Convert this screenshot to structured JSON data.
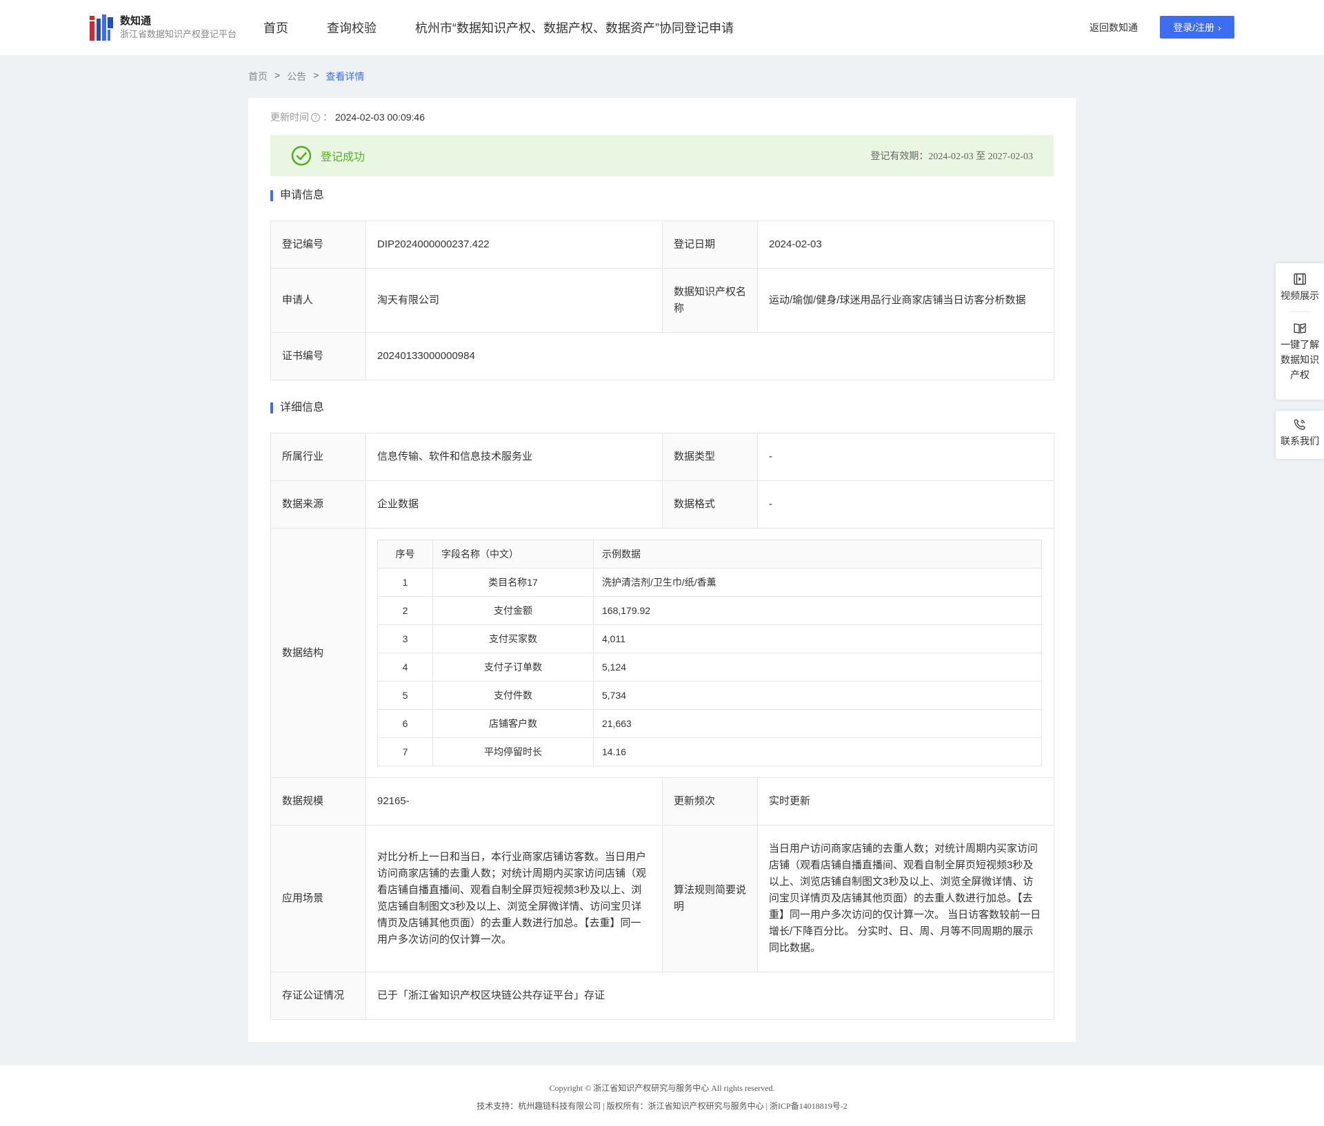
{
  "header": {
    "logo_title": "数知通",
    "logo_sub": "浙江省数据知识产权登记平台",
    "nav": [
      "首页",
      "查询校验",
      "杭州市“数据知识产权、数据产权、数据资产”协同登记申请"
    ],
    "back_link": "返回数知通",
    "login_label": "登录/注册"
  },
  "breadcrumb": {
    "items": [
      "首页",
      "公告",
      "查看详情"
    ],
    "sep": ">"
  },
  "update": {
    "label": "更新时间",
    "colon": "：",
    "value": "2024-02-03 00:09:46"
  },
  "status": {
    "text": "登记成功",
    "validity": "登记有效期：2024-02-03 至 2027-02-03",
    "color": "#52b11f"
  },
  "apply": {
    "title": "申请信息",
    "reg_no_label": "登记编号",
    "reg_no": "DIP2024000000237.422",
    "reg_date_label": "登记日期",
    "reg_date": "2024-02-03",
    "applicant_label": "申请人",
    "applicant": "淘天有限公司",
    "ip_name_label": "数据知识产权名称",
    "ip_name": "运动/瑜伽/健身/球迷用品行业商家店铺当日访客分析数据",
    "cert_label": "证书编号",
    "cert_no": "20240133000000984"
  },
  "detail": {
    "title": "详细信息",
    "industry_label": "所属行业",
    "industry": "信息传输、软件和信息技术服务业",
    "data_type_label": "数据类型",
    "data_type": "-",
    "source_label": "数据来源",
    "source": "企业数据",
    "format_label": "数据格式",
    "format": "-",
    "structure_label": "数据结构",
    "fields_header": [
      "序号",
      "字段名称（中文）",
      "示例数据"
    ],
    "fields": [
      {
        "no": "1",
        "name": "类目名称17",
        "sample": "洗护清洁剂/卫生巾/纸/香薰"
      },
      {
        "no": "2",
        "name": "支付金额",
        "sample": "168,179.92"
      },
      {
        "no": "3",
        "name": "支付买家数",
        "sample": "4,011"
      },
      {
        "no": "4",
        "name": "支付子订单数",
        "sample": "5,124"
      },
      {
        "no": "5",
        "name": "支付件数",
        "sample": "5,734"
      },
      {
        "no": "6",
        "name": "店铺客户数",
        "sample": "21,663"
      },
      {
        "no": "7",
        "name": "平均停留时长",
        "sample": "14.16"
      }
    ],
    "scale_label": "数据规模",
    "scale": "92165-",
    "freq_label": "更新频次",
    "freq": "实时更新",
    "scene_label": "应用场景",
    "scene": "对比分析上一日和当日，本行业商家店铺访客数。当日用户访问商家店铺的去重人数；对统计周期内买家访问店铺（观看店铺自播直播间、观看自制全屏页短视频3秒及以上、浏览店铺自制图文3秒及以上、浏览全屏微详情、访问宝贝详情页及店铺其他页面）的去重人数进行加总。【去重】同一用户多次访问的仅计算一次。",
    "algo_label": "算法规则简要说明",
    "algo": "当日用户访问商家店铺的去重人数；对统计周期内买家访问店铺（观看店铺自播直播间、观看自制全屏页短视频3秒及以上、浏览店铺自制图文3秒及以上、浏览全屏微详情、访问宝贝详情页及店铺其他页面）的去重人数进行加总。【去重】同一用户多次访问的仅计算一次。 当日访客数较前一日增长/下降百分比。 分实时、日、周、月等不同周期的展示同比数据。",
    "notary_label": "存证公证情况",
    "notary": "已于「浙江省知识产权区块链公共存证平台」存证"
  },
  "side": {
    "video": "视频展示",
    "learn": "一键了解数据知识产权",
    "contact": "联系我们"
  },
  "footer": {
    "copyright": "Copyright © 浙江省知识产权研究与服务中心 All rights reserved.",
    "support": "技术支持：杭州趣链科技有限公司 | 版权所有：浙江省知识产权研究与服务中心 | 浙ICP备14018819号-2"
  },
  "colors": {
    "accent": "#3b6ef5",
    "success_bg": "#e9f6e1",
    "page_bg": "#eef2f5"
  }
}
